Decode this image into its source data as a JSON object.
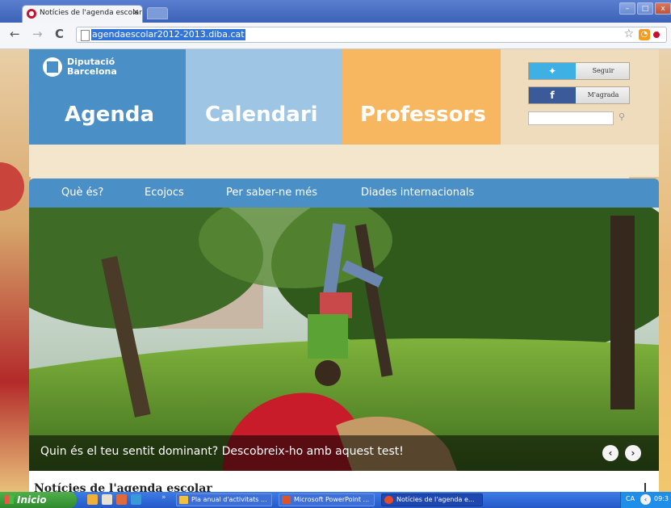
{
  "browser": {
    "tab_title": "Notícies de l'agenda escolar",
    "tab_close": "×",
    "url": "agendaescolar2012-2013.diba.cat",
    "back": "←",
    "forward": "→",
    "reload": "C",
    "star": "☆",
    "window_buttons": [
      "–",
      "□",
      "x"
    ]
  },
  "site": {
    "logo_line1": "Diputació",
    "logo_line2": "Barcelona",
    "main_nav": [
      "Agenda",
      "Calendari",
      "Professors"
    ],
    "social": {
      "follow_label": "Seguir",
      "like_label": "M'agrada",
      "twitter_icon": "twitter-bird",
      "facebook_icon": "f"
    },
    "search": {
      "placeholder": "",
      "icon": "search-icon"
    },
    "sub_nav": [
      "Què és?",
      "Ecojocs",
      "Per saber-ne més",
      "Diades internacionals"
    ],
    "hero": {
      "caption": "Quin és el teu sentit dominant? Descobreix-ho amb aquest test!",
      "prev": "‹",
      "next": "›"
    },
    "news_heading": "Notícies de l'agenda escolar",
    "colors": {
      "agenda": "#4a8fc6",
      "calendari": "#9fc5e4",
      "professors": "#f7b760",
      "social_panel": "#efdcbc"
    }
  },
  "taskbar": {
    "start_label": "Inicio",
    "more": "»",
    "tasks": [
      "Pla anual d'activitats ...",
      "Microsoft PowerPoint ...",
      "Notícies de l'agenda e..."
    ],
    "tray_lang": "CA",
    "tray_time": "09:3"
  }
}
